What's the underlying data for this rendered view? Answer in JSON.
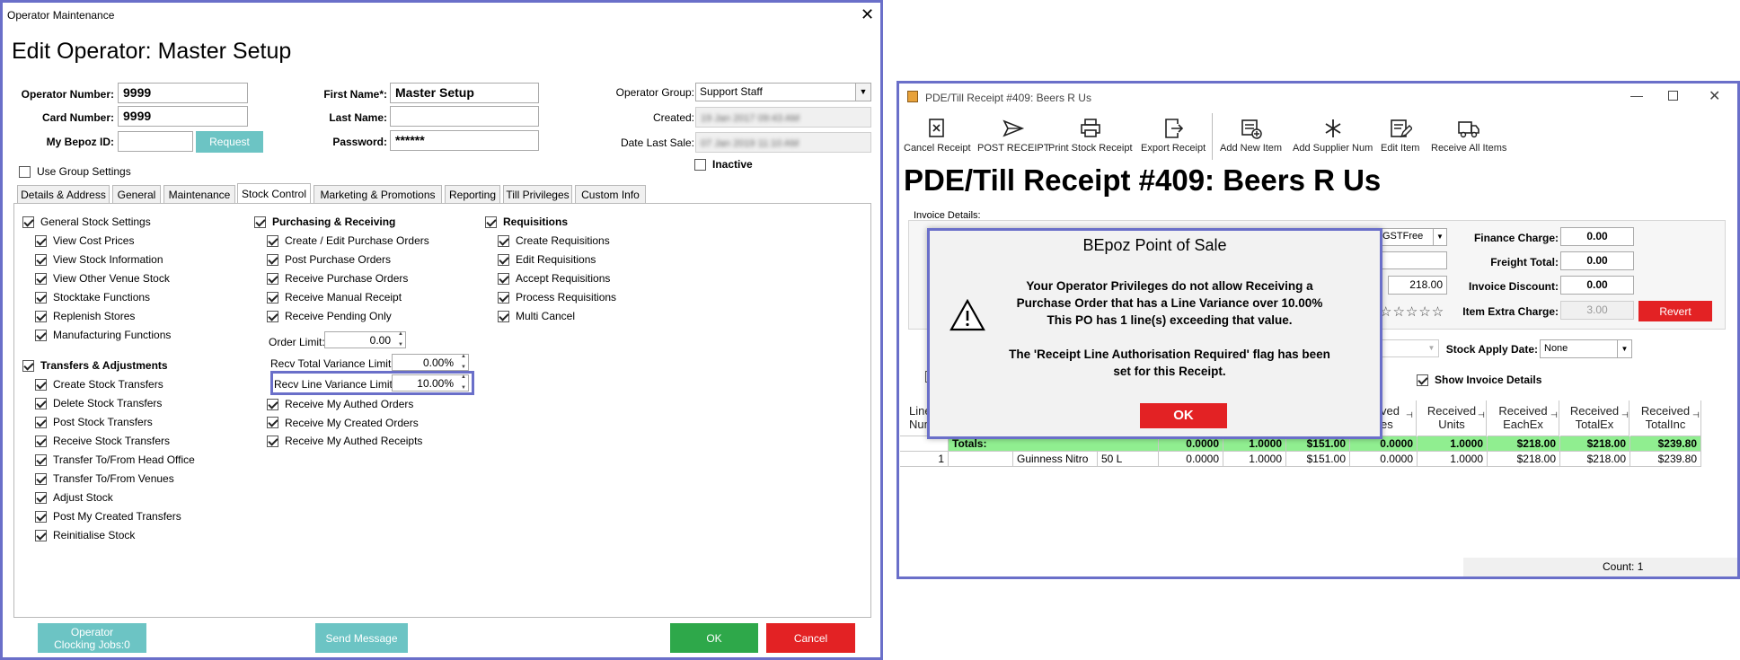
{
  "operator_window": {
    "title": "Operator Maintenance",
    "heading": "Edit Operator: Master Setup",
    "fields": {
      "operator_number_label": "Operator Number:",
      "operator_number": "9999",
      "card_number_label": "Card Number:",
      "card_number": "9999",
      "bepoz_id_label": "My Bepoz ID:",
      "bepoz_id": "",
      "request_label": "Request",
      "first_name_label": "First Name*:",
      "first_name": "Master Setup",
      "last_name_label": "Last Name:",
      "last_name": "",
      "password_label": "Password:",
      "password": "******",
      "operator_group_label": "Operator Group:",
      "operator_group": "Support Staff",
      "created_label": "Created:",
      "created": "19 Jan 2017 09:43 AM",
      "date_last_sale_label": "Date Last Sale:",
      "date_last_sale": "07 Jan 2019 11:10 AM",
      "use_group_settings": "Use Group Settings",
      "inactive": "Inactive"
    },
    "tabs": [
      "Details & Address",
      "General",
      "Maintenance",
      "Stock Control",
      "Marketing & Promotions",
      "Reporting",
      "Till Privileges",
      "Custom Info"
    ],
    "general_stock": {
      "title": "General Stock Settings",
      "items": [
        "View Cost Prices",
        "View Stock Information",
        "View Other Venue Stock",
        "Stocktake Functions",
        "Replenish Stores",
        "Manufacturing Functions"
      ]
    },
    "transfers": {
      "title": "Transfers & Adjustments",
      "items": [
        "Create Stock Transfers",
        "Delete Stock Transfers",
        "Post Stock Transfers",
        "Receive Stock Transfers",
        "Transfer To/From Head Office",
        "Transfer To/From Venues",
        "Adjust Stock",
        "Post My Created Transfers",
        "Reinitialise Stock"
      ]
    },
    "purchasing": {
      "title": "Purchasing & Receiving",
      "items": [
        "Create / Edit Purchase Orders",
        "Post Purchase Orders",
        "Receive Purchase Orders",
        "Receive Manual Receipt",
        "Receive Pending Only"
      ],
      "order_limit_label": "Order Limit:",
      "order_limit": "0.00",
      "recv_total_label": "Recv Total Variance Limit:",
      "recv_total": "0.00%",
      "recv_line_label": "Recv Line Variance Limit:",
      "recv_line": "10.00%",
      "items2": [
        "Receive My Authed Orders",
        "Receive My Created Orders",
        "Receive My Authed Receipts"
      ]
    },
    "requisitions": {
      "title": "Requisitions",
      "items": [
        "Create Requisitions",
        "Edit Requisitions",
        "Accept Requisitions",
        "Process Requisitions",
        "Multi Cancel"
      ]
    },
    "footer": {
      "clocking": "Operator\nClocking Jobs:0",
      "send_message": "Send Message",
      "ok": "OK",
      "cancel": "Cancel"
    }
  },
  "receipt_window": {
    "title": "PDE/Till Receipt #409: Beers R Us",
    "heading": "PDE/Till Receipt #409: Beers R Us",
    "toolbar": [
      "Cancel Receipt",
      "POST RECEIPT",
      "Print Stock Receipt",
      "Export Receipt",
      "Add New Item",
      "Add Supplier Num",
      "Edit Item",
      "Receive All Items"
    ],
    "invoice_details": "Invoice Details:",
    "gst_value": "GSTFree",
    "amount": "218.00",
    "finance_charge_label": "Finance Charge:",
    "finance_charge": "0.00",
    "freight_total_label": "Freight Total:",
    "freight_total": "0.00",
    "invoice_discount_label": "Invoice Discount:",
    "invoice_discount": "0.00",
    "item_extra_label": "Item Extra Charge:",
    "item_extra": "3.00",
    "revert": "Revert",
    "stock_apply_label": "Stock Apply Date:",
    "stock_apply": "None",
    "show_invoice_details": "Show Invoice Details",
    "columns_visible": [
      "Line\nNum",
      "ved\nes",
      "Received\nUnits",
      "Received\nEachEx",
      "Received\nTotalEx",
      "Received\nTotalInc"
    ],
    "totals_label": "Totals:",
    "totals": [
      "0.0000",
      "1.0000",
      "$151.00",
      "0.0000",
      "1.0000",
      "$218.00",
      "$218.00",
      "$239.80"
    ],
    "row": {
      "num": "1",
      "name": "Guinness Nitro",
      "size": "50 L",
      "values": [
        "0.0000",
        "1.0000",
        "$151.00",
        "0.0000",
        "1.0000",
        "$218.00",
        "$218.00",
        "$239.80"
      ]
    },
    "count": "Count: 1"
  },
  "dialog": {
    "title": "BEpoz Point of Sale",
    "line1": "Your Operator Privileges do not allow Receiving a",
    "line2": "Purchase Order that has a Line Variance over 10.00%",
    "line3": "This PO has 1 line(s) exceeding that value.",
    "line4": "The 'Receipt Line Authorisation Required' flag has been",
    "line5": "set for this Receipt.",
    "ok": "OK"
  },
  "colors": {
    "teal": "#6cc4c4",
    "green": "#2ea84a",
    "red": "#e32224",
    "highlight": "#6a6fc9",
    "grid_green": "#90ee90"
  }
}
